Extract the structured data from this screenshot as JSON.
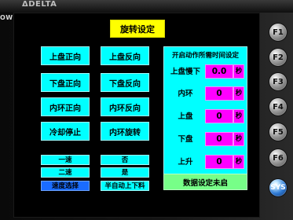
{
  "bezel": {
    "brand": "ΔDELTA",
    "power": "OWER"
  },
  "screen": {
    "title": "旋转设定",
    "buttons": {
      "r1c1": "上盘正向",
      "r1c2": "上盘反向",
      "r2c1": "下盘正向",
      "r2c2": "下盘反向",
      "r3c1": "内环正向",
      "r3c2": "内环反向",
      "r4c1": "冷却停止",
      "r4c2": "内环旋转"
    },
    "small_buttons": {
      "left": [
        "一速",
        "二速"
      ],
      "right": [
        "否",
        "是"
      ]
    },
    "bottom_labels": {
      "left": "速度选择",
      "right": "半自动上下料"
    },
    "panel": {
      "header": "开启动作所需时间设定",
      "rows": [
        {
          "label": "上盘慢下",
          "value": "0.0",
          "unit": "秒"
        },
        {
          "label": "内环",
          "value": "0",
          "unit": "秒"
        },
        {
          "label": "上盘",
          "value": "0",
          "unit": "秒"
        },
        {
          "label": "下盘",
          "value": "0",
          "unit": "秒"
        },
        {
          "label": "上升",
          "value": "0",
          "unit": "秒"
        }
      ]
    },
    "note": "数据设定未启"
  },
  "function_keys": [
    "F1",
    "F2",
    "F3",
    "F4",
    "F5",
    "F6",
    "SYS"
  ],
  "colors": {
    "title_bg": "#ffff00",
    "button_bg": "#00ffff",
    "value_bg": "#ff00ff",
    "note_bg": "#77ff88",
    "bottom_left_bg": "#1a6cff"
  }
}
